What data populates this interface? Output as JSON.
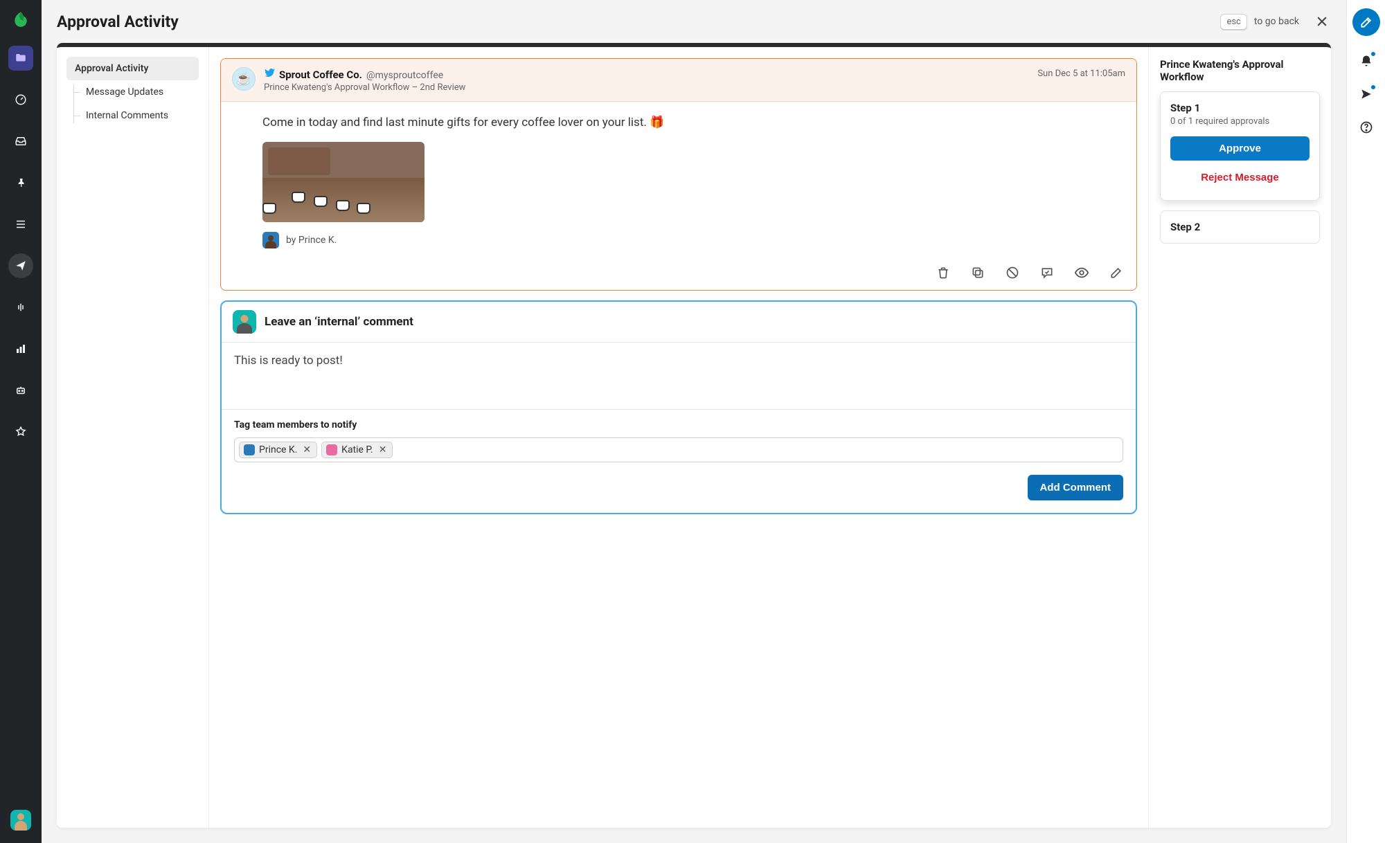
{
  "page": {
    "title": "Approval Activity",
    "esc_key": "esc",
    "go_back": "to go back"
  },
  "nav": {
    "items": [
      {
        "label": "Approval Activity",
        "active": true
      },
      {
        "label": "Message Updates"
      },
      {
        "label": "Internal Comments"
      }
    ]
  },
  "post": {
    "platform": "twitter",
    "account_name": "Sprout Coffee Co.",
    "account_handle": "@mysproutcoffee",
    "workflow_line": "Prince Kwateng's Approval Workflow – 2nd Review",
    "timestamp": "Sun Dec 5 at 11:05am",
    "body_text": "Come in today and find last minute gifts for every coffee lover on your list. 🎁",
    "byline": "by Prince K."
  },
  "post_actions": [
    {
      "name": "delete-icon"
    },
    {
      "name": "copy-icon"
    },
    {
      "name": "block-icon"
    },
    {
      "name": "comment-icon"
    },
    {
      "name": "preview-icon"
    },
    {
      "name": "edit-icon"
    }
  ],
  "comment": {
    "title": "Leave an ‘internal’ comment",
    "body": "This is ready to post!",
    "tag_label": "Tag team members to notify",
    "tags": [
      {
        "name": "Prince K."
      },
      {
        "name": "Katie P."
      }
    ],
    "submit": "Add Comment"
  },
  "workflow": {
    "title": "Prince Kwateng's Approval Workflow",
    "steps": [
      {
        "label": "Step 1",
        "sub": "0 of 1 required approvals",
        "approve": "Approve",
        "reject": "Reject Message",
        "expanded": true
      },
      {
        "label": "Step 2",
        "expanded": false
      }
    ]
  }
}
